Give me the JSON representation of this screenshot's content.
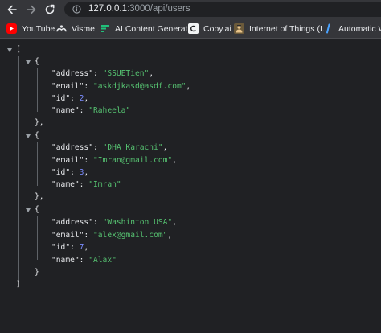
{
  "browser": {
    "url_host": "127.0.0.1",
    "url_path": ":3000/api/users"
  },
  "bookmarks": [
    {
      "label": "YouTube",
      "icon": "youtube-icon",
      "color": "#ff0000"
    },
    {
      "label": "Visme",
      "icon": "visme-icon",
      "color": "#e8eaed"
    },
    {
      "label": "AI Content Generat...",
      "icon": "ai-content-icon",
      "color": "#21c07a"
    },
    {
      "label": "Copy.ai",
      "icon": "copyai-icon",
      "color": "#e8eaed"
    },
    {
      "label": "Internet of Things (I...",
      "icon": "iot-icon",
      "color": "#c9a15a"
    },
    {
      "label": "Automatic Wh",
      "icon": "automatic-icon",
      "color": "#4aa3ff"
    }
  ],
  "json_view": {
    "open_bracket": "[",
    "close_bracket": "]",
    "users": [
      {
        "address": "\"SSUETien\"",
        "email": "\"askdjkasd@asdf.com\"",
        "id": "2",
        "name": "\"Raheela\"",
        "close": "},"
      },
      {
        "address": "\"DHA Karachi\"",
        "email": "\"Imran@gmail.com\"",
        "id": "3",
        "name": "\"Imran\"",
        "close": "},"
      },
      {
        "address": "\"Washinton USA\"",
        "email": "\"alex@gmail.com\"",
        "id": "7",
        "name": "\"Alax\"",
        "close": "}"
      }
    ],
    "keys": {
      "address": "\"address\"",
      "email": "\"email\"",
      "id": "\"id\"",
      "name": "\"name\""
    },
    "colors": {
      "string": "#56c271",
      "number": "#7b8cff",
      "key": "#e8eaed"
    }
  }
}
